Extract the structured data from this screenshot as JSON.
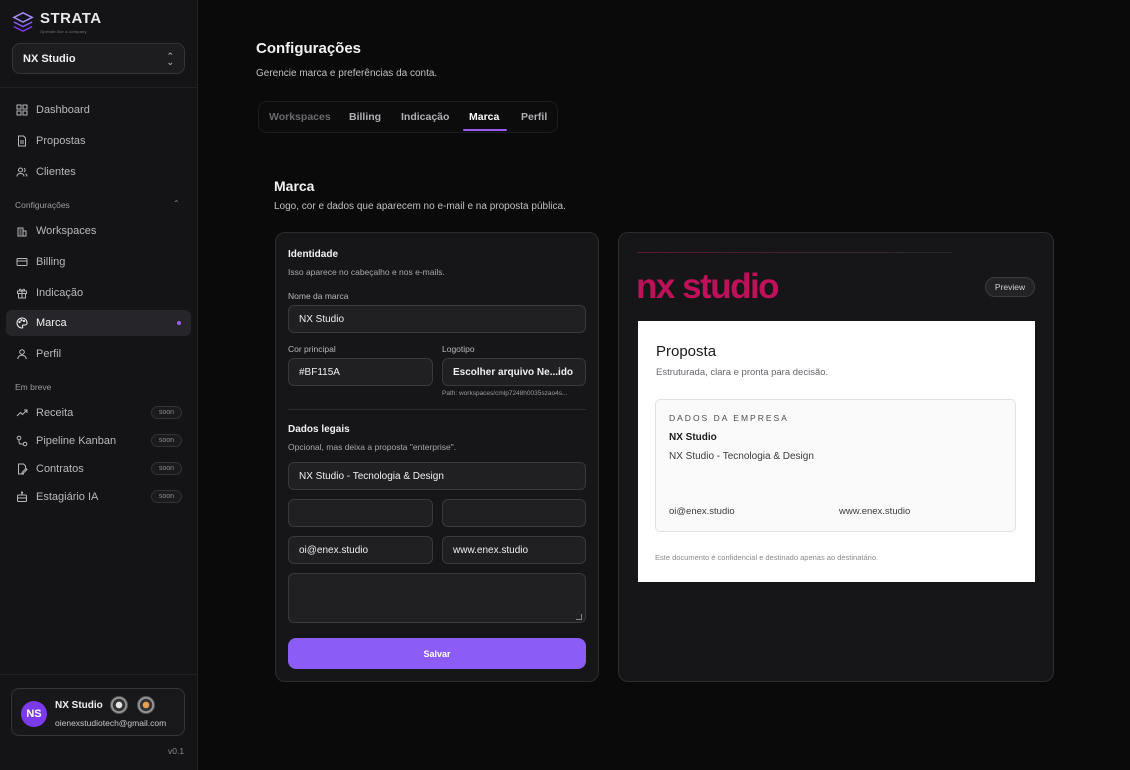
{
  "brand": {
    "name": "STRATA",
    "tagline": "Operate like a company"
  },
  "workspace_select": {
    "value": "NX Studio"
  },
  "nav": {
    "main": [
      {
        "label": "Dashboard",
        "icon": "grid-icon"
      },
      {
        "label": "Propostas",
        "icon": "document-icon"
      },
      {
        "label": "Clientes",
        "icon": "users-icon"
      }
    ],
    "settings_section": "Configurações",
    "settings": [
      {
        "label": "Workspaces",
        "icon": "building-icon"
      },
      {
        "label": "Billing",
        "icon": "card-icon"
      },
      {
        "label": "Indicação",
        "icon": "gift-icon"
      },
      {
        "label": "Marca",
        "icon": "palette-icon"
      },
      {
        "label": "Perfil",
        "icon": "user-icon"
      }
    ],
    "soon_section": "Em breve",
    "soon": [
      {
        "label": "Receita",
        "badge": "soon",
        "icon": "trend-icon"
      },
      {
        "label": "Pipeline Kanban",
        "badge": "soon",
        "icon": "workflow-icon"
      },
      {
        "label": "Contratos",
        "badge": "soon",
        "icon": "contract-icon"
      },
      {
        "label": "Estagiário IA",
        "badge": "soon",
        "icon": "bot-icon"
      }
    ]
  },
  "user": {
    "initials": "NS",
    "name": "NX Studio",
    "email": "oienexstudiotech@gmail.com"
  },
  "version": "v0.1",
  "page": {
    "title": "Configurações",
    "subtitle": "Gerencie marca e preferências da conta."
  },
  "tabs": [
    "Workspaces",
    "Billing",
    "Indicação",
    "Marca",
    "Perfil"
  ],
  "section": {
    "title": "Marca",
    "subtitle": "Logo, cor e dados que aparecem no e-mail e na proposta pública."
  },
  "form": {
    "identity_title": "Identidade",
    "identity_sub": "Isso aparece no cabeçalho e nos e-mails.",
    "brand_name_label": "Nome da marca",
    "brand_name_value": "NX Studio",
    "color_label": "Cor principal",
    "color_value": "#BF115A",
    "logo_label": "Logotipo",
    "logo_button": "Escolher arquivo Ne...ido",
    "logo_path": "Path: workspaces/cmlp7248h0035szao4s...",
    "legal_title": "Dados legais",
    "legal_sub": "Opcional, mas deixa a proposta \"enterprise\".",
    "legal_name": "NX Studio - Tecnologia & Design",
    "field_a": "",
    "field_b": "",
    "email": "oi@enex.studio",
    "website": "www.enex.studio",
    "address": "",
    "save_label": "Salvar"
  },
  "preview": {
    "logo_text": "nx studio",
    "preview_button": "Preview",
    "doc_title": "Proposta",
    "doc_subtitle": "Estruturada, clara e pronta para decisão.",
    "company_label": "DADOS DA EMPRESA",
    "company_name": "NX Studio",
    "company_legal": "NX Studio - Tecnologia & Design",
    "email": "oi@enex.studio",
    "website": "www.enex.studio",
    "footer": "Este documento é confidencial e destinado apenas ao destinatário."
  },
  "colors": {
    "accent": "#8b5cf6",
    "brand": "#bf115a",
    "bg": "#0a0a0b",
    "sidebar": "#141416"
  }
}
